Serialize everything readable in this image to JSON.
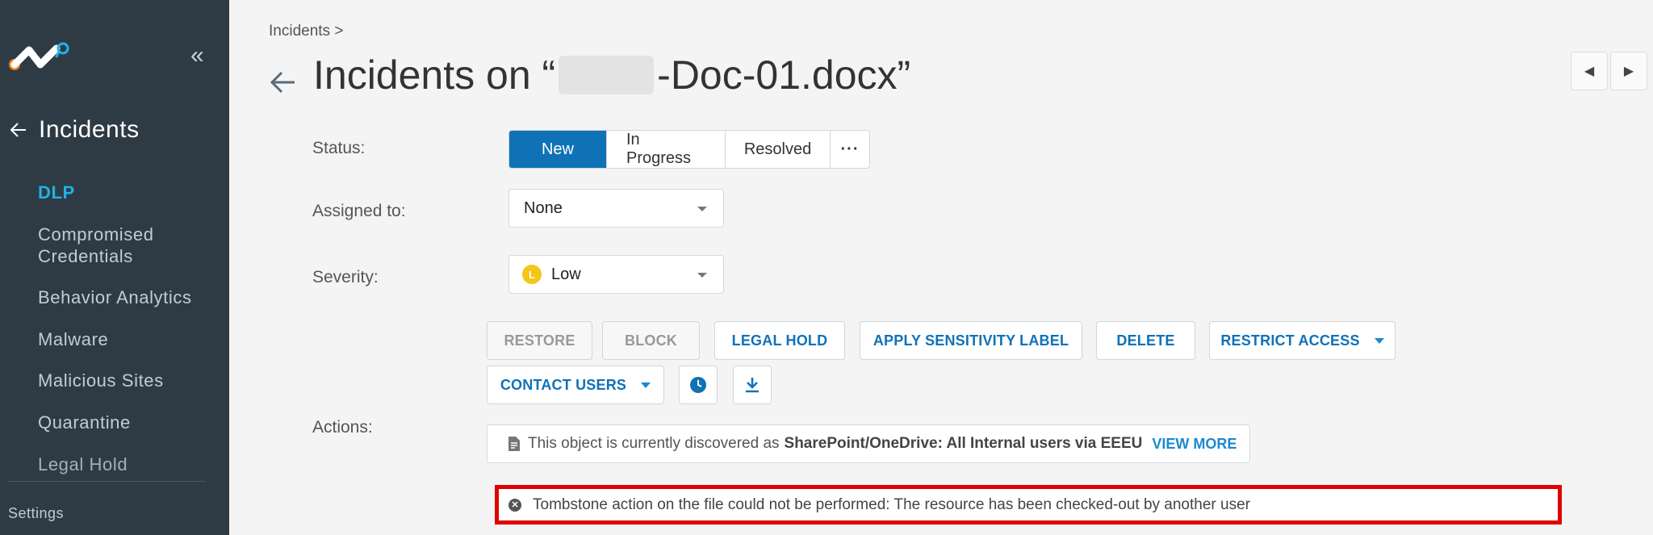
{
  "sidebar": {
    "back_label": "Incidents",
    "items": [
      {
        "label": "DLP",
        "active": true
      },
      {
        "label": "Compromised\nCredentials"
      },
      {
        "label": "Behavior Analytics"
      },
      {
        "label": "Malware"
      },
      {
        "label": "Malicious Sites"
      },
      {
        "label": "Quarantine"
      },
      {
        "label": "Legal Hold"
      }
    ],
    "settings_label": "Settings",
    "logo_icon": "netskope-logo",
    "collapse_icon": "double-chevron-left-icon"
  },
  "breadcrumb": "Incidents >",
  "title": {
    "prefix": "Incidents on “",
    "suffix": "-Doc-01.docx”"
  },
  "status": {
    "label": "Status:",
    "options": [
      "New",
      "In Progress",
      "Resolved",
      "···"
    ],
    "selected": "New"
  },
  "assigned": {
    "label": "Assigned to:",
    "value": "None"
  },
  "severity": {
    "label": "Severity:",
    "value": "Low",
    "badge": "L",
    "color": "#f5c518"
  },
  "actions": {
    "label": "Actions:",
    "buttons": {
      "restore": "RESTORE",
      "block": "BLOCK",
      "legal_hold": "LEGAL HOLD",
      "apply_label": "APPLY SENSITIVITY LABEL",
      "delete": "DELETE",
      "restrict": "RESTRICT ACCESS",
      "contact": "CONTACT USERS"
    }
  },
  "info": {
    "text": "This object is currently discovered as",
    "bold": "SharePoint/OneDrive: All Internal users via EEEU",
    "link": "VIEW MORE"
  },
  "error": {
    "text": "Tombstone action on the file could not be performed: The resource has been checked-out by another user"
  },
  "colors": {
    "accent": "#0f72b6",
    "sidebar_bg": "#2e3b45",
    "active_nav": "#1fb3e6",
    "error_border": "#e00000"
  }
}
